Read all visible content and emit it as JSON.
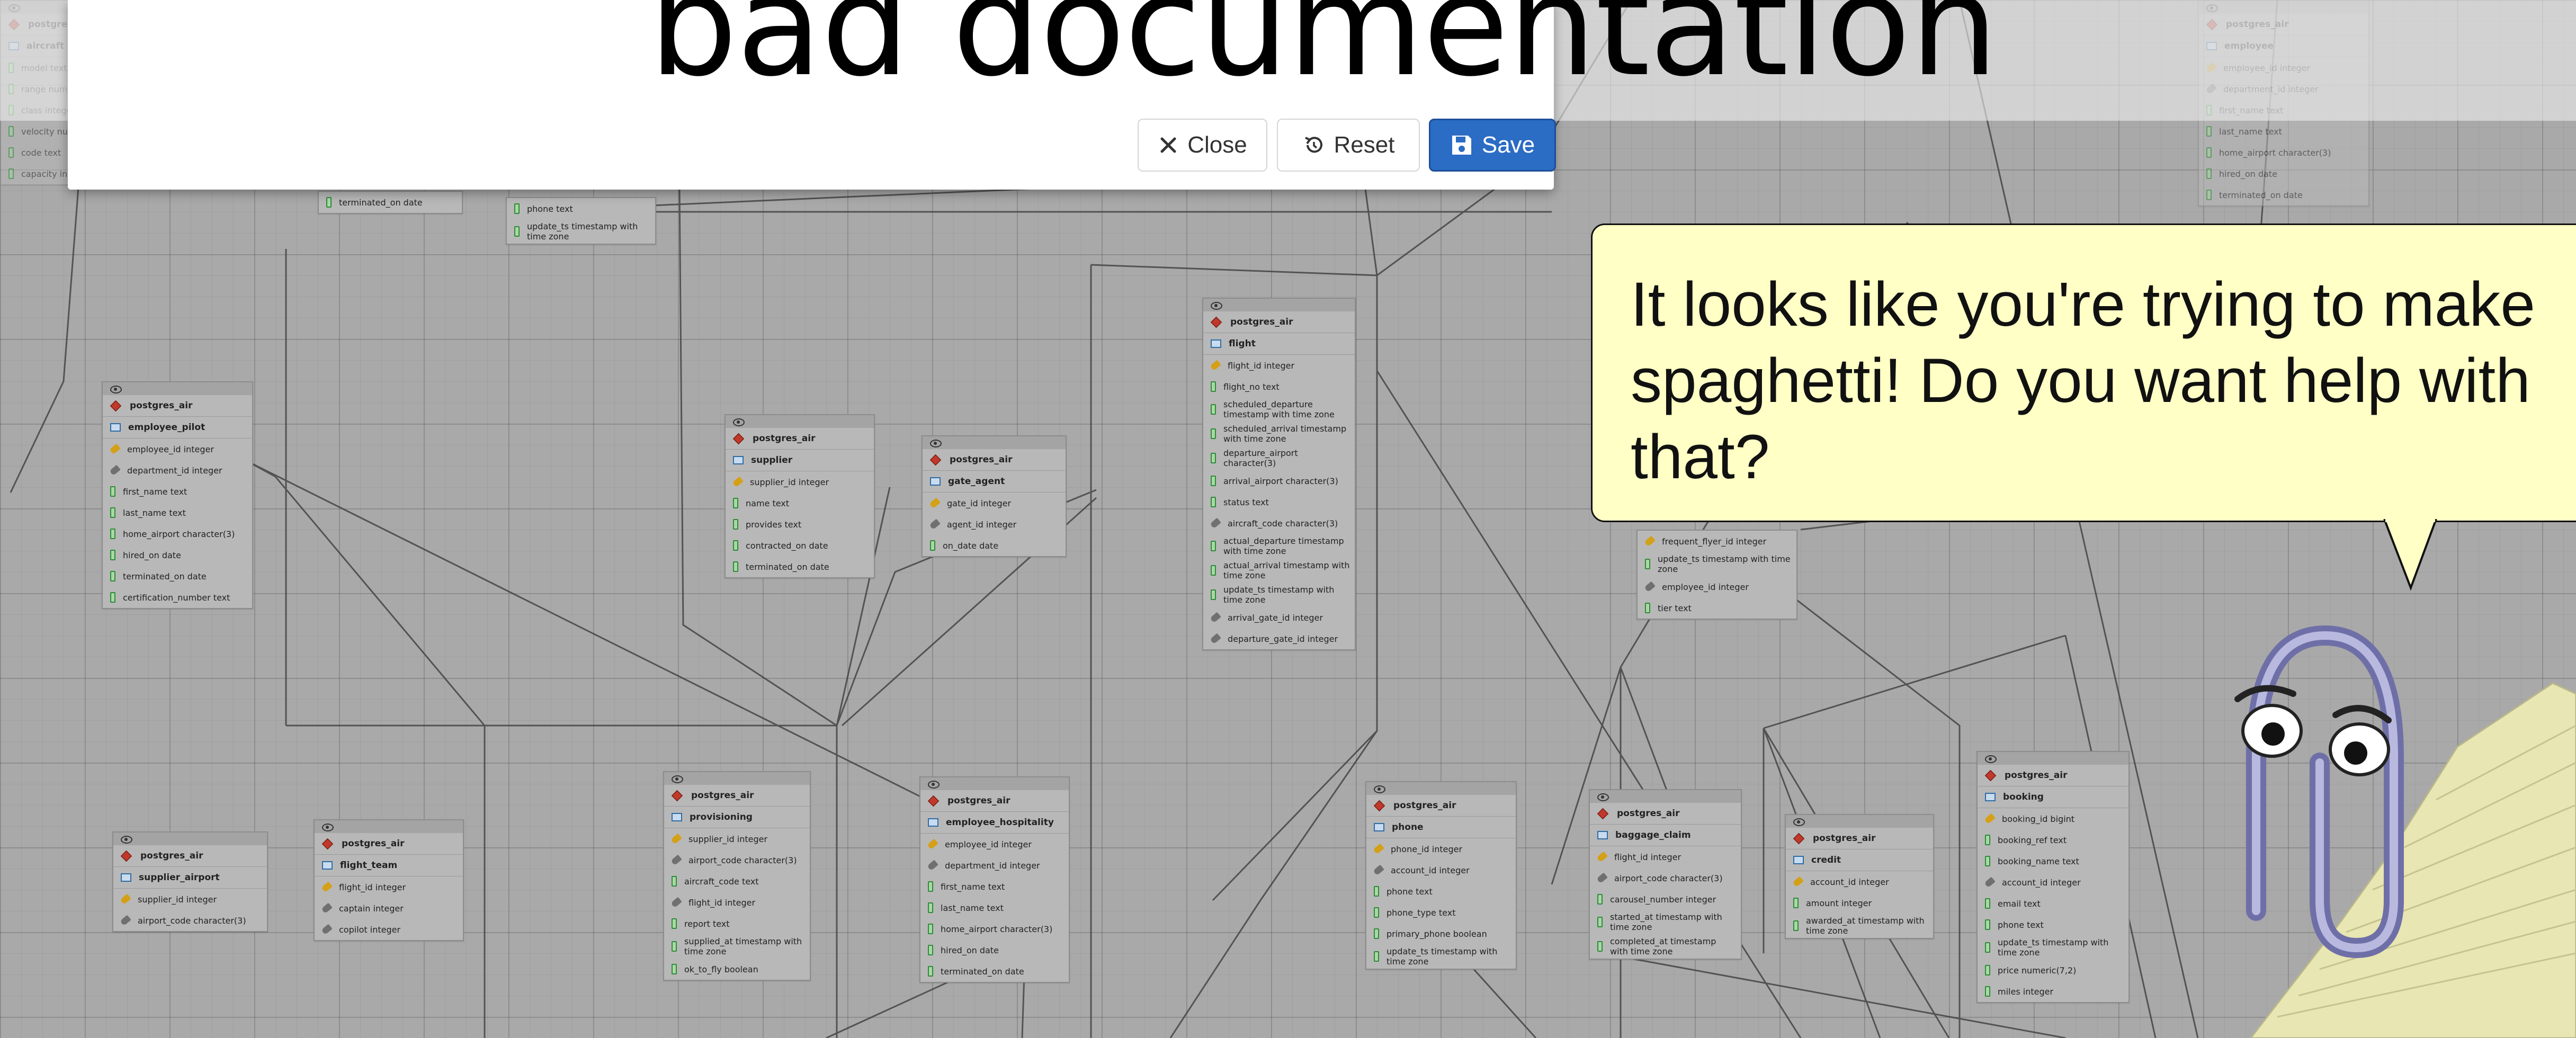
{
  "modal": {
    "title": "bad documentation",
    "close_label": "Close",
    "reset_label": "Reset",
    "save_label": "Save"
  },
  "bubble": {
    "text": "It looks like you're trying to make spaghetti! Do you want help with that?"
  },
  "colors": {
    "save_button": "#2b6cc4",
    "bubble_background": "#ffffc6",
    "canvas_background": "#a9a9a9",
    "schema_icon": "#c0392b"
  },
  "icons": {
    "close": "close-icon",
    "reset": "reset-icon",
    "save": "floppy-disk-icon",
    "view": "eye-icon",
    "schema": "schema-icon",
    "table": "table-icon",
    "primary_key": "key-icon",
    "foreign_key": "foreign-key-icon",
    "column": "column-icon"
  },
  "tables": [
    {
      "schema": "postgres_air",
      "name": "employee_pilot",
      "columns": [
        "employee_id integer",
        "department_id integer",
        "first_name text",
        "last_name text",
        "home_airport character(3)",
        "hired_on date",
        "terminated_on date",
        "certification_number text"
      ]
    },
    {
      "schema": "postgres_air",
      "name": "supplier",
      "columns": [
        "supplier_id integer",
        "name text",
        "provides text",
        "contracted_on date",
        "terminated_on date"
      ]
    },
    {
      "schema": "postgres_air",
      "name": "gate_agent",
      "columns": [
        "gate_id integer",
        "agent_id integer",
        "on_date date"
      ]
    },
    {
      "schema": "postgres_air",
      "name": "flight",
      "columns": [
        "flight_id integer",
        "flight_no text",
        "scheduled_departure timestamp with time zone",
        "scheduled_arrival timestamp with time zone",
        "departure_airport character(3)",
        "arrival_airport character(3)",
        "status text",
        "aircraft_code character(3)",
        "actual_departure timestamp with time zone",
        "actual_arrival timestamp with time zone",
        "update_ts timestamp with time zone",
        "arrival_gate_id integer",
        "departure_gate_id integer"
      ]
    },
    {
      "schema": "postgres_air",
      "name": "supplier_airport",
      "columns": [
        "supplier_id integer",
        "airport_code character(3)"
      ]
    },
    {
      "schema": "postgres_air",
      "name": "flight_team",
      "columns": [
        "flight_id integer",
        "captain integer",
        "copilot integer"
      ]
    },
    {
      "schema": "postgres_air",
      "name": "provisioning",
      "columns": [
        "supplier_id integer",
        "airport_code character(3)",
        "aircraft_code text",
        "flight_id integer",
        "report text",
        "supplied_at timestamp with time zone",
        "ok_to_fly boolean"
      ]
    },
    {
      "schema": "postgres_air",
      "name": "employee_hospitality",
      "columns": [
        "employee_id integer",
        "department_id integer",
        "first_name text",
        "last_name text",
        "home_airport character(3)",
        "hired_on date",
        "terminated_on date"
      ]
    },
    {
      "schema": "postgres_air",
      "name": "phone",
      "columns": [
        "phone_id integer",
        "account_id integer",
        "phone text",
        "phone_type text",
        "primary_phone boolean",
        "update_ts timestamp with time zone"
      ]
    },
    {
      "schema": "postgres_air",
      "name": "baggage_claim",
      "columns": [
        "flight_id integer",
        "airport_code character(3)",
        "carousel_number integer",
        "started_at timestamp with time zone",
        "completed_at timestamp with time zone"
      ]
    },
    {
      "schema": "postgres_air",
      "name": "credit",
      "columns": [
        "account_id integer",
        "amount integer",
        "awarded_at timestamp with time zone"
      ]
    },
    {
      "schema": "postgres_air",
      "name": "booking",
      "columns": [
        "booking_id bigint",
        "booking_ref text",
        "booking_name text",
        "account_id integer",
        "email text",
        "phone text",
        "update_ts timestamp with time zone",
        "price numeric(7,2)",
        "miles integer"
      ]
    },
    {
      "schema": "",
      "name": "",
      "columns": [
        "frequent_flyer_id integer",
        "update_ts timestamp with time zone",
        "employee_id integer",
        "tier text"
      ]
    },
    {
      "schema": "",
      "name": "",
      "columns": [
        "phone text",
        "update_ts timestamp with time zone"
      ]
    },
    {
      "schema": "",
      "name": "",
      "columns": [
        "terminated_on date"
      ]
    },
    {
      "schema": "postgres_air",
      "name": "employee",
      "columns": [
        "employee_id integer",
        "department_id integer",
        "first_name text",
        "last_name text",
        "home_airport character(3)",
        "hired_on date",
        "terminated_on date"
      ]
    },
    {
      "schema": "postgres_air",
      "name": "aircraft",
      "columns": [
        "model text",
        "range numeric",
        "class integer",
        "velocity numeric",
        "code text",
        "capacity integer"
      ]
    }
  ]
}
